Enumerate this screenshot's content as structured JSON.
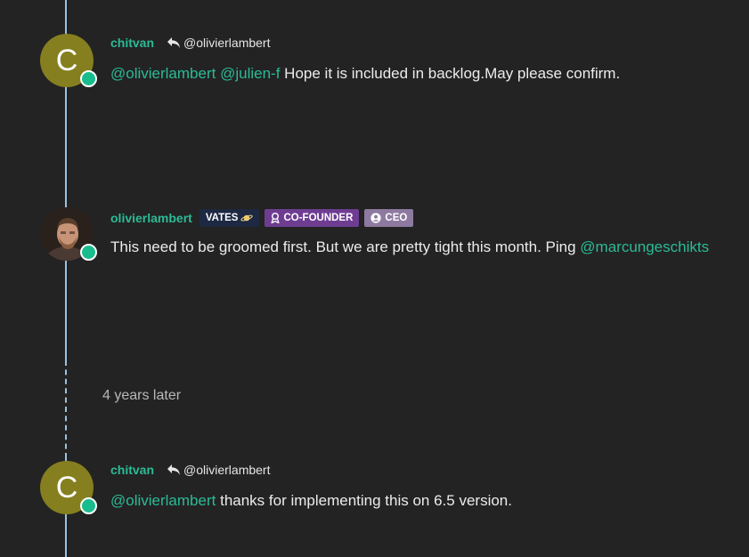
{
  "posts": [
    {
      "avatar_letter": "C",
      "username": "chitvan",
      "reply_to": "@olivierlambert",
      "mentions": [
        "@olivierlambert",
        "@julien-f"
      ],
      "text": "Hope it is included in backlog.May please confirm."
    },
    {
      "username": "olivierlambert",
      "badges": [
        "VATES",
        "CO-FOUNDER",
        "CEO"
      ],
      "text": "This need to be groomed first. But we are pretty tight this month. Ping",
      "mention": "@marcungeschikts"
    },
    {
      "avatar_letter": "C",
      "username": "chitvan",
      "reply_to": "@olivierlambert",
      "mention": "@olivierlambert",
      "text": "thanks for implementing this on 6.5 version."
    }
  ],
  "time_gap": "4 years later",
  "colors": {
    "background": "#232323",
    "accent": "#2bbb96",
    "timeline": "#9cc2e0",
    "online": "#19bc8d",
    "avatar_c": "#867f1f"
  },
  "icons": [
    "reply-icon",
    "planet-icon",
    "award-icon",
    "user-circle-icon"
  ]
}
